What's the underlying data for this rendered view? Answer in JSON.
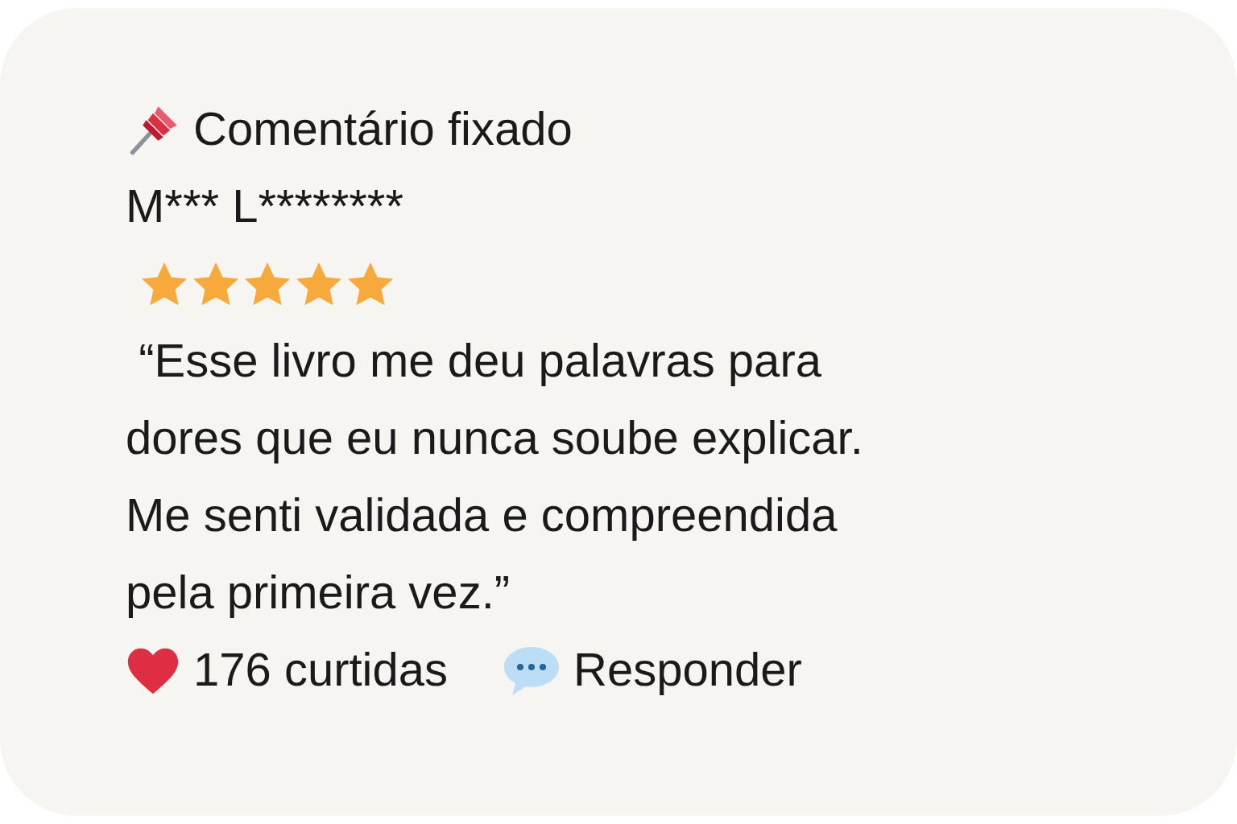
{
  "comment": {
    "pinned_label": "Comentário fixado",
    "author": "M*** L********",
    "stars": 5,
    "text": " “Esse livro me deu palavras para dores que eu nunca soube explicar. Me senti validada e compreendida pela primeira vez.”",
    "likes": "176 curtidas",
    "reply": "Responder"
  }
}
